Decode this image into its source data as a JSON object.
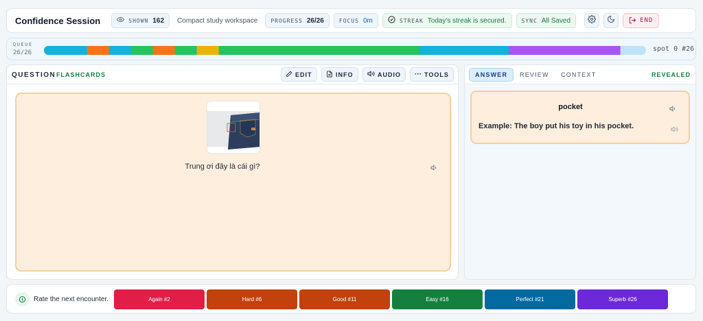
{
  "header": {
    "title": "Confidence Session",
    "shown_label": "SHOWN",
    "shown_value": "162",
    "subtitle": "Compact study workspace",
    "progress_label": "PROGRESS",
    "progress_value": "26/26",
    "focus_label": "FOCUS",
    "focus_value": "0m",
    "streak_label": "STREAK",
    "streak_value": "Today's streak is secured.",
    "sync_label": "SYNC",
    "sync_value": "All Saved",
    "end_label": "END"
  },
  "queue": {
    "label": "QUEUE",
    "count": "26/26",
    "spot": "spot 0 #26",
    "segments": [
      {
        "weight": 5.5,
        "color": "#12b3d6"
      },
      {
        "weight": 2.8,
        "color": "#f97316"
      },
      {
        "weight": 2.8,
        "color": "#12b3d6"
      },
      {
        "weight": 2.8,
        "color": "#22c55e"
      },
      {
        "weight": 2.8,
        "color": "#f97316"
      },
      {
        "weight": 2.8,
        "color": "#22c55e"
      },
      {
        "weight": 2.8,
        "color": "#eab308"
      },
      {
        "weight": 25.6,
        "color": "#22c55e"
      },
      {
        "weight": 11.4,
        "color": "#12b3d6"
      },
      {
        "weight": 14.2,
        "color": "#a855f7"
      }
    ],
    "total_weight": 76.8
  },
  "question": {
    "title": "QUESTION",
    "deck": "FLASHCARDS",
    "edit_label": "EDIT",
    "info_label": "INFO",
    "audio_label": "AUDIO",
    "tools_label": "TOOLS",
    "prompt": "Trung ơi đây là cái gì?"
  },
  "answer": {
    "tabs": [
      "ANSWER",
      "REVIEW",
      "CONTEXT"
    ],
    "status": "REVEALED",
    "word": "pocket",
    "example": "Example: The boy put his toy in his pocket."
  },
  "rating": {
    "prompt": "Rate the next encounter.",
    "buttons": [
      {
        "label": "Again #2",
        "color": "#e11d48"
      },
      {
        "label": "Hard #6",
        "color": "#c2410c"
      },
      {
        "label": "Good #11",
        "color": "#c2410c"
      },
      {
        "label": "Easy #16",
        "color": "#15803d"
      },
      {
        "label": "Perfect #21",
        "color": "#0369a1"
      },
      {
        "label": "Superb #26",
        "color": "#6d28d9"
      }
    ]
  }
}
